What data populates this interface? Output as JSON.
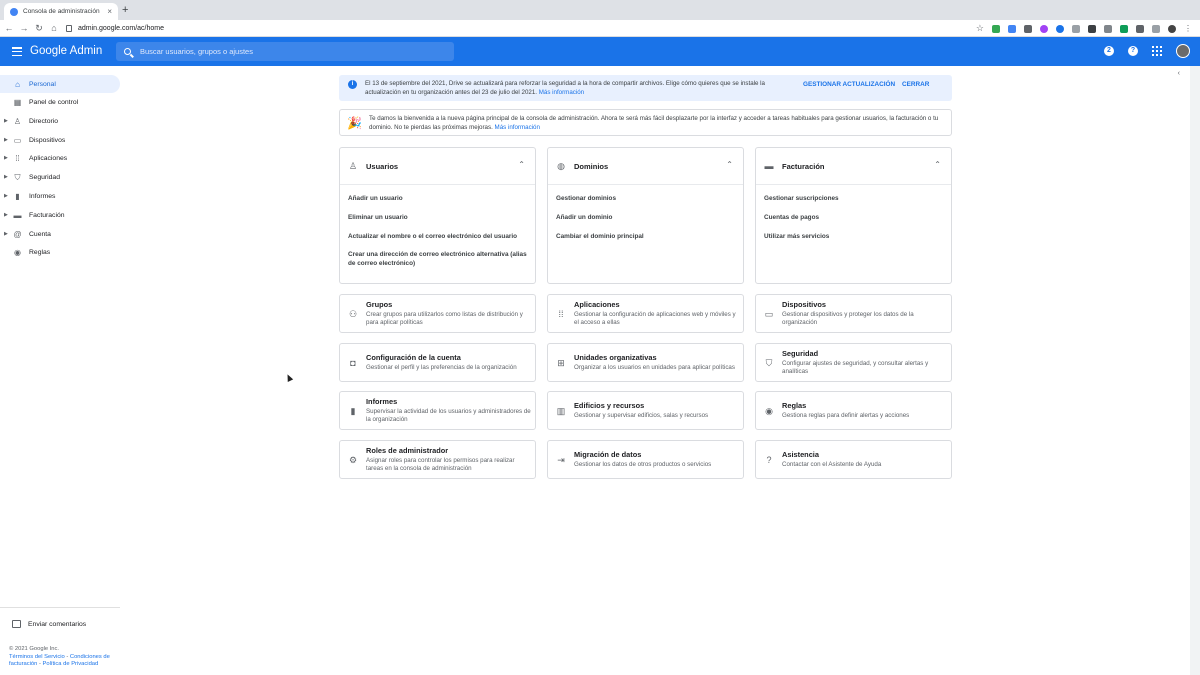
{
  "browser": {
    "tab_title": "Consola de administración",
    "url": "admin.google.com/ac/home"
  },
  "header": {
    "brand": "Google Admin",
    "search_placeholder": "Buscar usuarios, grupos o ajustes",
    "accent_color": "#1a73e8"
  },
  "sidebar": {
    "items": [
      {
        "label": "Personal",
        "icon": "home-icon",
        "active": true
      },
      {
        "label": "Panel de control",
        "icon": "dashboard-icon"
      },
      {
        "label": "Directorio",
        "icon": "person-icon"
      },
      {
        "label": "Dispositivos",
        "icon": "devices-icon"
      },
      {
        "label": "Aplicaciones",
        "icon": "apps-icon"
      },
      {
        "label": "Seguridad",
        "icon": "shield-icon"
      },
      {
        "label": "Informes",
        "icon": "bar-chart-icon"
      },
      {
        "label": "Facturación",
        "icon": "credit-card-icon"
      },
      {
        "label": "Cuenta",
        "icon": "at-icon"
      },
      {
        "label": "Reglas",
        "icon": "rules-icon"
      }
    ],
    "feedback": "Enviar comentarios",
    "footer_copyright": "© 2021 Google Inc.",
    "footer_terms": "Términos del Servicio",
    "footer_billing": "Condiciones de facturación",
    "footer_privacy": "Política de Privacidad"
  },
  "banner": {
    "text": "El 13 de septiembre del 2021, Drive se actualizará para reforzar la seguridad a la hora de compartir archivos. Elige cómo quieres que se instale la actualización en tu organización antes del 23 de julio del 2021.",
    "link": "Más información",
    "action_manage": "GESTIONAR ACTUALIZACIÓN",
    "action_close": "CERRAR"
  },
  "welcome": {
    "text": "Te damos la bienvenida a la nueva página principal de la consola de administración. Ahora te será más fácil desplazarte por la interfaz y acceder a tareas habituales para gestionar usuarios, la facturación o tu dominio. No te pierdas las próximas mejoras.",
    "link": "Más información"
  },
  "cards": [
    {
      "title": "Usuarios",
      "icon": "person-icon",
      "links": [
        "Añadir un usuario",
        "Eliminar un usuario",
        "Actualizar el nombre o el correo electrónico del usuario",
        "Crear una dirección de correo electrónico alternativa (alias de correo electrónico)"
      ]
    },
    {
      "title": "Dominios",
      "icon": "globe-icon",
      "links": [
        "Gestionar dominios",
        "Añadir un dominio",
        "Cambiar el dominio principal"
      ]
    },
    {
      "title": "Facturación",
      "icon": "credit-card-icon",
      "links": [
        "Gestionar suscripciones",
        "Cuentas de pagos",
        "Utilizar más servicios"
      ]
    }
  ],
  "tiles": [
    {
      "title": "Grupos",
      "desc": "Crear grupos para utilizarlos como listas de distribución y para aplicar políticas",
      "icon": "groups-icon"
    },
    {
      "title": "Aplicaciones",
      "desc": "Gestionar la configuración de aplicaciones web y móviles y el acceso a ellas",
      "icon": "apps-icon"
    },
    {
      "title": "Dispositivos",
      "desc": "Gestionar dispositivos y proteger los datos de la organización",
      "icon": "devices-icon"
    },
    {
      "title": "Configuración de la cuenta",
      "desc": "Gestionar el perfil y las preferencias de la organización",
      "icon": "briefcase-icon"
    },
    {
      "title": "Unidades organizativas",
      "desc": "Organizar a los usuarios en unidades para aplicar políticas",
      "icon": "org-units-icon"
    },
    {
      "title": "Seguridad",
      "desc": "Configurar ajustes de seguridad, y consultar alertas y analíticas",
      "icon": "shield-icon"
    },
    {
      "title": "Informes",
      "desc": "Supervisar la actividad de los usuarios y administradores de la organización",
      "icon": "bar-chart-icon"
    },
    {
      "title": "Edificios y recursos",
      "desc": "Gestionar y supervisar edificios, salas y recursos",
      "icon": "building-icon"
    },
    {
      "title": "Reglas",
      "desc": "Gestiona reglas para definir alertas y acciones",
      "icon": "rules-icon"
    },
    {
      "title": "Roles de administrador",
      "desc": "Asignar roles para controlar los permisos para realizar tareas en la consola de administración",
      "icon": "admin-roles-icon"
    },
    {
      "title": "Migración de datos",
      "desc": "Gestionar los datos de otros productos o servicios",
      "icon": "migration-icon"
    },
    {
      "title": "Asistencia",
      "desc": "Contactar con el Asistente de Ayuda",
      "icon": "help-icon"
    }
  ]
}
